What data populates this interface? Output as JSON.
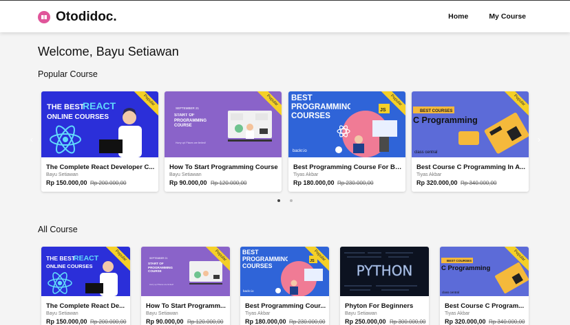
{
  "nav": {
    "brand": "Otodidoc.",
    "links": [
      "Home",
      "My Course"
    ]
  },
  "welcome": "Welcome, Bayu Setiawan",
  "popular": {
    "title": "Popular Course",
    "ribbon": "Popular",
    "courses": [
      {
        "title": "The Complete React Developer C...",
        "author": "Bayu Setiawan",
        "price": "Rp 150.000,00",
        "old_price": "Rp 200.000,00"
      },
      {
        "title": "How To Start Programming Course",
        "author": "Bayu Setiawan",
        "price": "Rp 90.000,00",
        "old_price": "Rp 120.000,00"
      },
      {
        "title": "Best Programming Course For Be...",
        "author": "Tiyas Akbar",
        "price": "Rp 180.000,00",
        "old_price": "Rp 230.000,00"
      },
      {
        "title": "Best Course C Programming In A...",
        "author": "Tiyas Akbar",
        "price": "Rp 320.000,00",
        "old_price": "Rp 340.000,00"
      }
    ]
  },
  "all": {
    "title": "All Course",
    "courses": [
      {
        "title": "The Complete React De...",
        "author": "Bayu Setiawan",
        "price": "Rp 150.000,00",
        "old_price": "Rp 200.000,00"
      },
      {
        "title": "How To Start Programm...",
        "author": "Bayu Setiawan",
        "price": "Rp 90.000,00",
        "old_price": "Rp 120.000,00"
      },
      {
        "title": "Best Programming Cour...",
        "author": "Tiyas Akbar",
        "price": "Rp 180.000,00",
        "old_price": "Rp 230.000,00"
      },
      {
        "title": "Phyton For Beginners",
        "author": "Bayu Setiawan",
        "price": "Rp 250.000,00",
        "old_price": "Rp 300.000,00"
      },
      {
        "title": "Best Course C Program...",
        "author": "Tiyas Akbar",
        "price": "Rp 320.000,00",
        "old_price": "Rp 340.000,00"
      }
    ]
  },
  "thumbs": {
    "react": {
      "line1": "THE BEST",
      "accent": "REACT",
      "line2": "ONLINE COURSES"
    },
    "start": {
      "date": "SEPTEMBER 21",
      "text": "START OF PROGRAMMING COURSE",
      "foot": "Hurry up! Places are limited!"
    },
    "best": {
      "text": "BEST PROGRAMMING COURSES",
      "badge": "JS",
      "brand": "backr.io"
    },
    "c": {
      "badge": "BEST COURSES",
      "text": "C Programming",
      "brand": "class central"
    },
    "python": {
      "text": "PYTHON"
    }
  },
  "colors": {
    "brand": "#e0559a",
    "ribbon": "#f5d027",
    "react_bg": "#2b2fd9",
    "start_bg": "#8a63c9",
    "best_bg": "#2f64d8",
    "c_bg": "#5c6bd8",
    "python_bg": "#0c1220"
  }
}
